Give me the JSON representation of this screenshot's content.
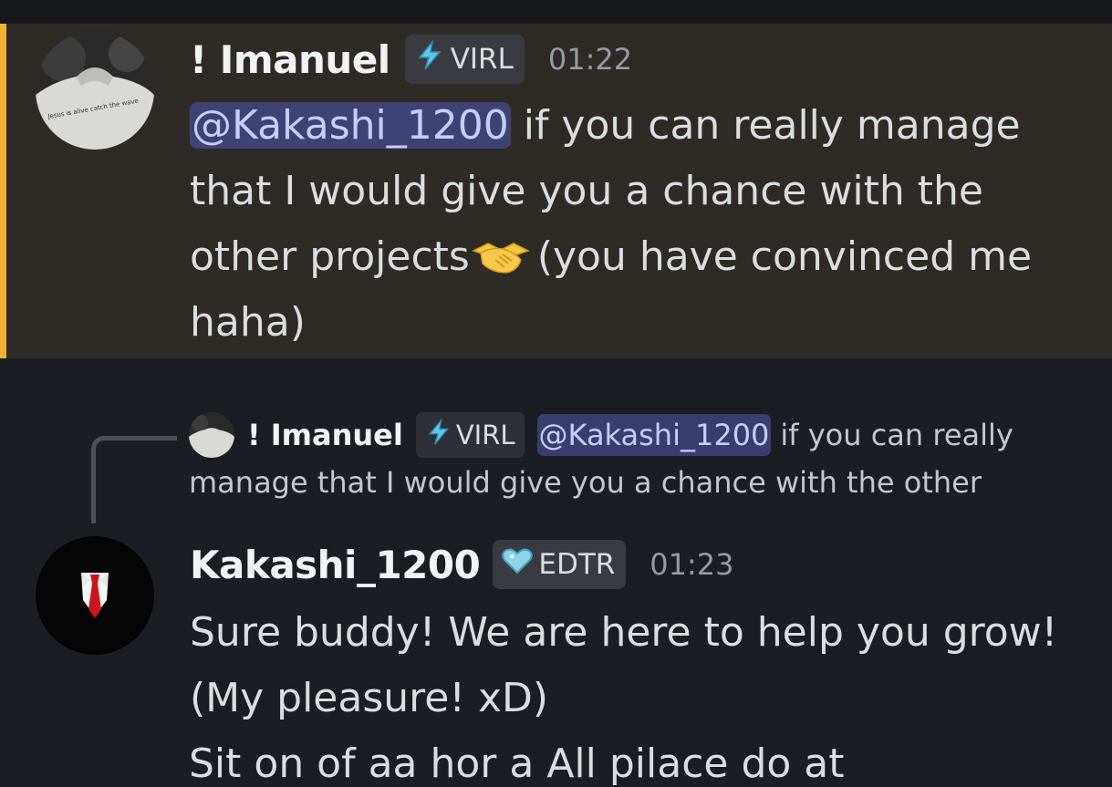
{
  "messages": [
    {
      "username": "! Imanuel",
      "badge": {
        "icon": "lightning-icon",
        "label": "VIRL"
      },
      "time": "01:22",
      "avatar_caption": "Jesus is alive catch the wave",
      "mention": "@Kakashi_1200",
      "lines": [
        " if you can really manage",
        "that I would give you a chance with the",
        "other projects",
        " (you have convinced me",
        "haha)"
      ],
      "emoji": "handshake-icon",
      "highlight_color": "#f0b232"
    },
    {
      "reply": {
        "username": "! Imanuel",
        "badge": {
          "icon": "lightning-icon",
          "label": "VIRL"
        },
        "mention": "@Kakashi_1200",
        "line1": "if you can really",
        "line2": "manage that I would give you a chance with the other"
      },
      "username": "Kakashi_1200",
      "badge": {
        "icon": "heart-icon",
        "label": "EDTR"
      },
      "time": "01:23",
      "lines": [
        "Sure buddy! We are here to help you grow!",
        "(My pleasure! xD)"
      ]
    }
  ],
  "cutoff_text": "Sit on of aa hor a All pilace do at"
}
